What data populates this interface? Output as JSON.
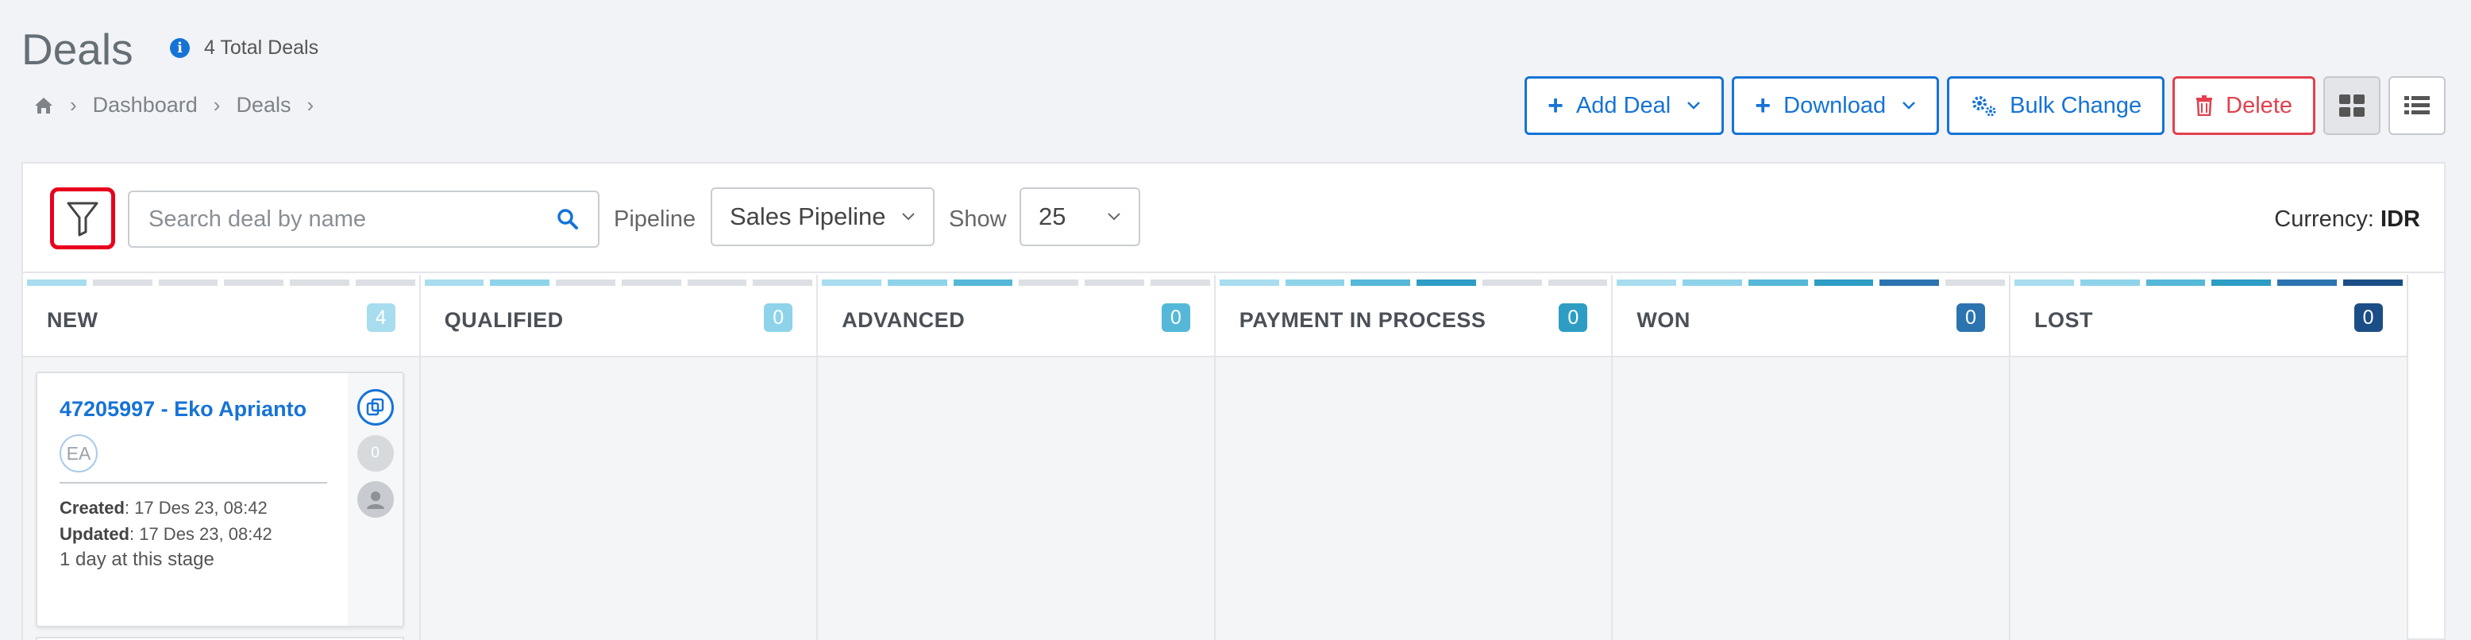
{
  "page": {
    "title": "Deals",
    "total_label": "4 Total Deals"
  },
  "breadcrumb": {
    "items": [
      "Dashboard",
      "Deals"
    ]
  },
  "toolbar": {
    "add_deal": "Add Deal",
    "download": "Download",
    "bulk_change": "Bulk Change",
    "delete": "Delete"
  },
  "filters": {
    "search_placeholder": "Search deal by name",
    "pipeline_label": "Pipeline",
    "pipeline_value": "Sales Pipeline",
    "show_label": "Show",
    "show_value": "25",
    "currency_label": "Currency:",
    "currency_value": "IDR"
  },
  "columns": [
    {
      "title": "NEW",
      "count": "4",
      "badge_color": "#a8dcef",
      "filled": 1,
      "seg_colors": [
        "#a8dcef"
      ]
    },
    {
      "title": "QUALIFIED",
      "count": "0",
      "badge_color": "#8ed3ea",
      "filled": 2,
      "seg_colors": [
        "#a8dcef",
        "#8ed3ea"
      ]
    },
    {
      "title": "ADVANCED",
      "count": "0",
      "badge_color": "#55b8d8",
      "filled": 3,
      "seg_colors": [
        "#a8dcef",
        "#8ed3ea",
        "#55b8d8"
      ]
    },
    {
      "title": "PAYMENT IN PROCESS",
      "count": "0",
      "badge_color": "#2e9dc4",
      "filled": 4,
      "seg_colors": [
        "#a8dcef",
        "#8ed3ea",
        "#55b8d8",
        "#2e9dc4"
      ]
    },
    {
      "title": "WON",
      "count": "0",
      "badge_color": "#2c74b0",
      "filled": 5,
      "seg_colors": [
        "#a8dcef",
        "#8ed3ea",
        "#55b8d8",
        "#2e9dc4",
        "#2c74b0"
      ]
    },
    {
      "title": "LOST",
      "count": "0",
      "badge_color": "#1b4e86",
      "filled": 6,
      "seg_colors": [
        "#a8dcef",
        "#8ed3ea",
        "#55b8d8",
        "#2e9dc4",
        "#2c74b0",
        "#1b4e86"
      ]
    }
  ],
  "deal_card": {
    "title": "47205997 - Eko Aprianto",
    "avatar": "EA",
    "created_label": "Created",
    "created_value": ": 17 Des 23, 08:42",
    "updated_label": "Updated",
    "updated_value": ": 17 Des 23, 08:42",
    "stage_text": "1 day at this stage",
    "comment_count": "0"
  },
  "colors": {
    "primary": "#1673d6",
    "danger": "#e2404f",
    "highlight": "#e8001c"
  }
}
